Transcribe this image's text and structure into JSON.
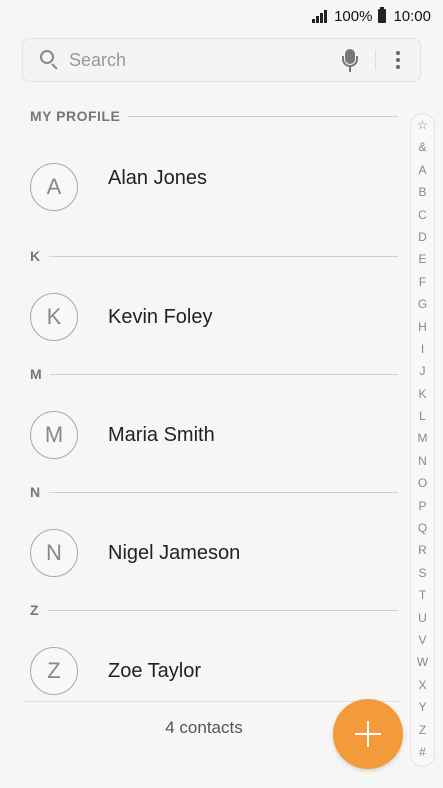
{
  "status_bar": {
    "battery_percent": "100%",
    "time": "10:00",
    "icons": [
      "signal-icon",
      "battery-icon"
    ]
  },
  "search": {
    "placeholder": "Search",
    "value": "",
    "icons": [
      "search-icon",
      "mic-icon",
      "more-options-icon"
    ]
  },
  "sections": [
    {
      "label": "MY PROFILE",
      "contacts": [
        {
          "initial": "A",
          "name": "Alan Jones"
        }
      ]
    },
    {
      "label": "K",
      "contacts": [
        {
          "initial": "K",
          "name": "Kevin Foley"
        }
      ]
    },
    {
      "label": "M",
      "contacts": [
        {
          "initial": "M",
          "name": "Maria Smith"
        }
      ]
    },
    {
      "label": "N",
      "contacts": [
        {
          "initial": "N",
          "name": "Nigel Jameson"
        }
      ]
    },
    {
      "label": "Z",
      "contacts": [
        {
          "initial": "Z",
          "name": "Zoe Taylor"
        }
      ]
    }
  ],
  "footer": {
    "count_text": "4 contacts"
  },
  "index": [
    "☆",
    "&",
    "A",
    "B",
    "C",
    "D",
    "E",
    "F",
    "G",
    "H",
    "I",
    "J",
    "K",
    "L",
    "M",
    "N",
    "O",
    "P",
    "Q",
    "R",
    "S",
    "T",
    "U",
    "V",
    "W",
    "X",
    "Y",
    "Z",
    "#"
  ],
  "fab": {
    "icon": "plus-icon",
    "color": "#f39a3b"
  }
}
